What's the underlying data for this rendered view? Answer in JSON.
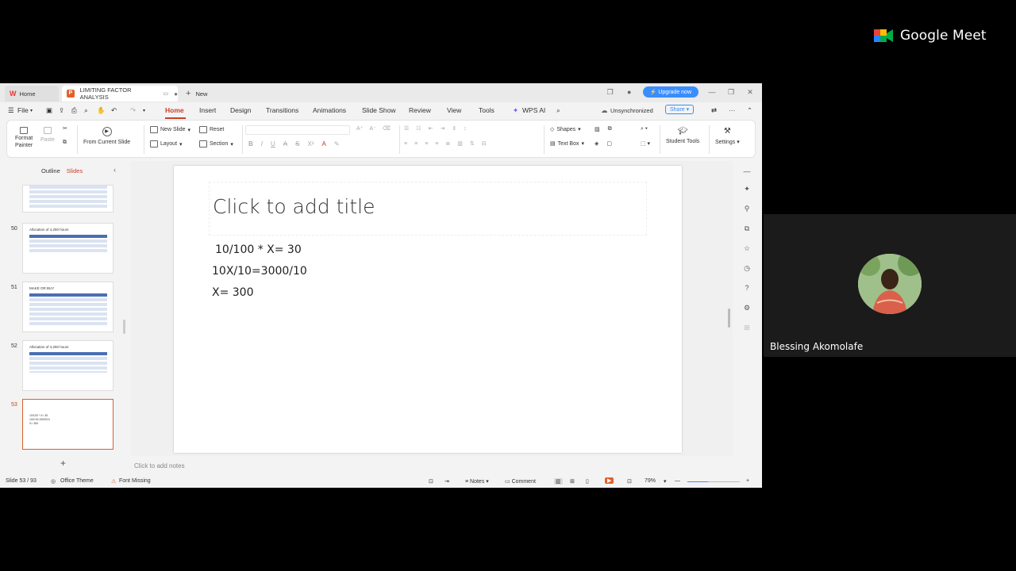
{
  "meet": {
    "brand": "Google Meet"
  },
  "participant": {
    "name": "Blessing Akomolafe"
  },
  "wps": {
    "tabs": {
      "home": "Home",
      "doc": "LIMITING FACTOR ANALYSIS",
      "new": "New"
    },
    "upgrade": "Upgrade now",
    "menu": {
      "file": "File",
      "items": [
        "Home",
        "Insert",
        "Design",
        "Transitions",
        "Animations",
        "Slide Show",
        "Review",
        "View",
        "Tools",
        "WPS AI"
      ],
      "unsync": "Unsynchronized",
      "share": "Share"
    },
    "ribbon": {
      "format_painter_1": "Format",
      "format_painter_2": "Painter",
      "paste": "Paste",
      "from_current": "From Current Slide",
      "new_slide": "New Slide",
      "reset": "Reset",
      "layout": "Layout",
      "section": "Section",
      "shapes": "Shapes",
      "text_box": "Text Box",
      "student_tools": "Student Tools",
      "settings": "Settings"
    },
    "panel": {
      "outline": "Outline",
      "slides": "Slides"
    },
    "thumbs": [
      {
        "num": "",
        "title": ""
      },
      {
        "num": "50",
        "title": "Allocation of 4,250 hours"
      },
      {
        "num": "51",
        "title": "MAKE OR BUY"
      },
      {
        "num": "52",
        "title": "Allocation of 4,250 hours"
      },
      {
        "num": "53",
        "title": ""
      }
    ],
    "slide": {
      "title_placeholder": "Click to add title",
      "lines": [
        "10/100 * X= 30",
        "10X/10=3000/10",
        "X= 300"
      ]
    },
    "notes_placeholder": "Click to add notes",
    "status": {
      "slide_pos": "Slide 53 / 93",
      "theme": "Office Theme",
      "font_missing": "Font Missing",
      "notes": "Notes",
      "comment": "Comment",
      "zoom": "79%",
      "zoom_level": 0.4
    }
  }
}
